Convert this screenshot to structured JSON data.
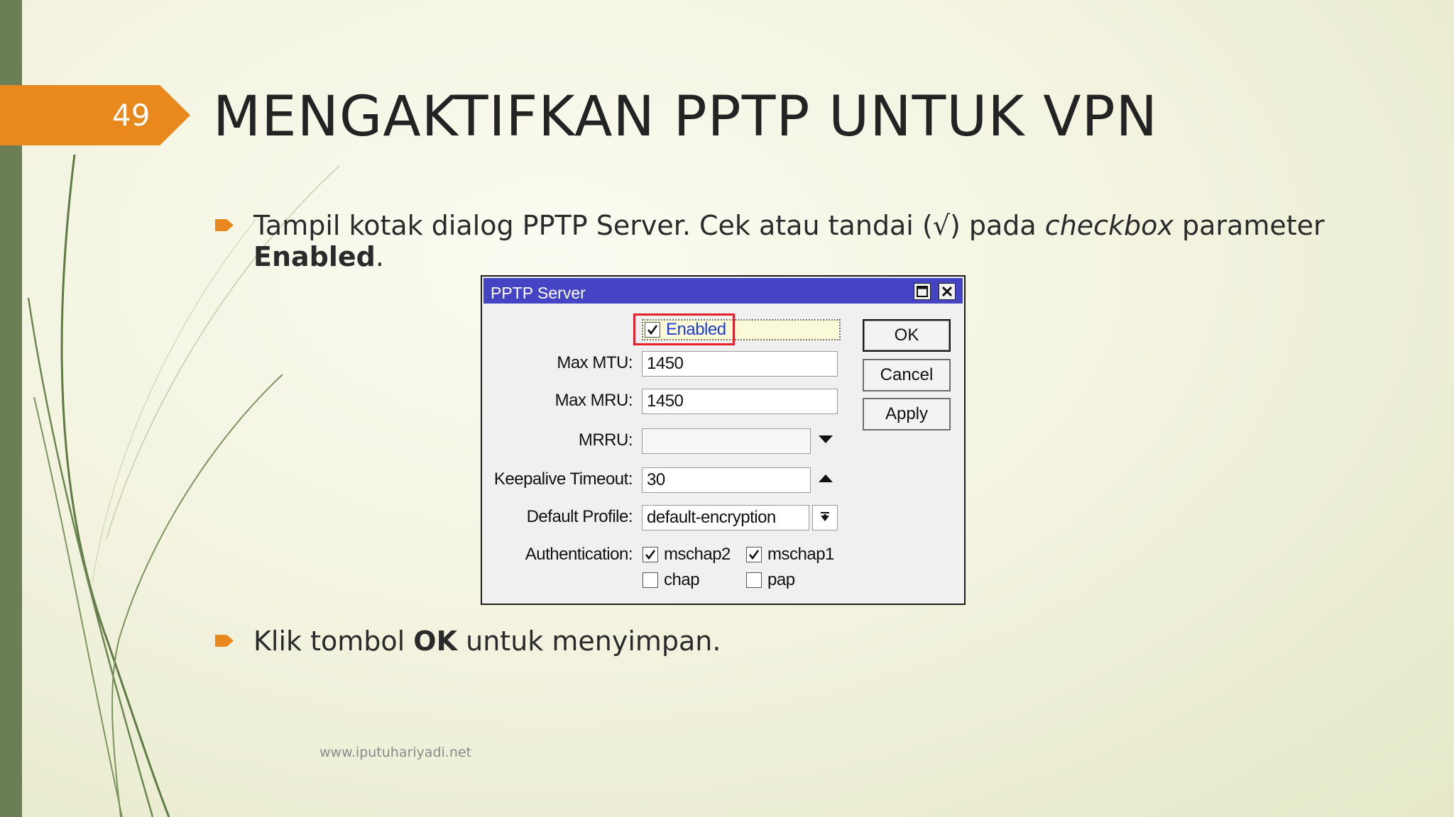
{
  "slide": {
    "number": "49",
    "title": "MENGAKTIFKAN PPTP UNTUK VPN",
    "bullets": [
      {
        "line1_a": "Tampil kotak dialog PPTP Server. Cek atau tandai (√) pada ",
        "line1_italic": "checkbox",
        "line1_b": " parameter",
        "line2_bold": "Enabled",
        "line2_rest": "."
      },
      {
        "text_a": "Klik tombol ",
        "text_bold": "OK",
        "text_b": " untuk menyimpan."
      }
    ],
    "footer": "www.iputuhariyadi.net",
    "colors": {
      "accent": "#e9881c",
      "left_bar": "#6c7e55",
      "dialog_title": "#4444c4",
      "highlight": "#e5202a"
    }
  },
  "dialog": {
    "title": "PPTP Server",
    "enabled": {
      "label": "Enabled",
      "checked": true
    },
    "fields": {
      "max_mtu": {
        "label": "Max MTU:",
        "value": "1450"
      },
      "max_mru": {
        "label": "Max MRU:",
        "value": "1450"
      },
      "mrru": {
        "label": "MRRU:",
        "value": ""
      },
      "keepalive_timeout": {
        "label": "Keepalive Timeout:",
        "value": "30"
      },
      "default_profile": {
        "label": "Default Profile:",
        "value": "default-encryption"
      }
    },
    "authentication": {
      "label": "Authentication:",
      "options": [
        {
          "label": "mschap2",
          "checked": true
        },
        {
          "label": "mschap1",
          "checked": true
        },
        {
          "label": "chap",
          "checked": false
        },
        {
          "label": "pap",
          "checked": false
        }
      ]
    },
    "buttons": {
      "ok": "OK",
      "cancel": "Cancel",
      "apply": "Apply"
    },
    "icons": [
      "maximize-icon",
      "close-icon",
      "dropdown-arrow-icon",
      "up-arrow-icon",
      "select-arrow-icon",
      "checkmark-icon"
    ]
  }
}
